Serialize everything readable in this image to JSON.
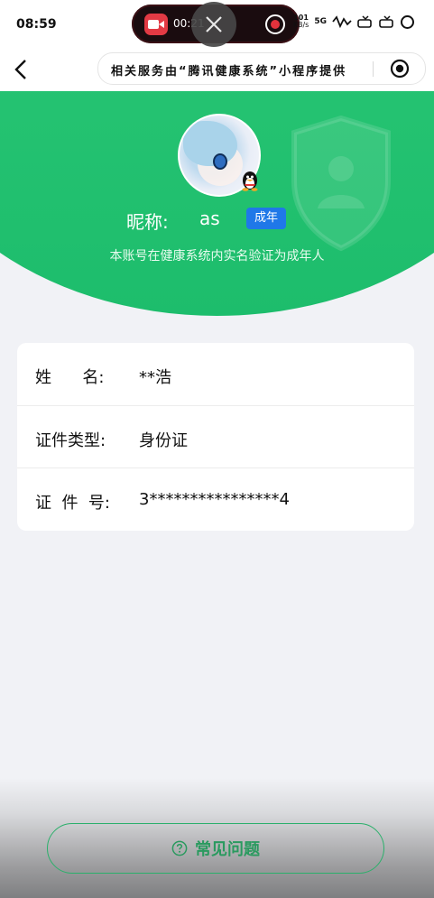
{
  "status_bar": {
    "time": "08:59",
    "recording_timer": "00:21",
    "net_speed_value": "101",
    "net_speed_unit": "KB/s",
    "network": "5G"
  },
  "nav": {
    "service_text": "相关服务由“腾讯健康系统”小程序提供"
  },
  "profile": {
    "nickname_label": "昵称:",
    "nickname_value": "as",
    "age_badge": "成年",
    "verification_text": "本账号在健康系统内实名验证为成年人"
  },
  "identity": {
    "rows": [
      {
        "label": "姓      名:",
        "value": "**浩"
      },
      {
        "label": "证件类型:",
        "value": "身份证"
      },
      {
        "label": "证  件  号:",
        "value": "3****************4"
      }
    ]
  },
  "footer": {
    "faq_label": "常见问题"
  },
  "colors": {
    "brand_green": "#1dbd6c",
    "badge_blue": "#1f78e8",
    "record_red": "#e23a44"
  }
}
